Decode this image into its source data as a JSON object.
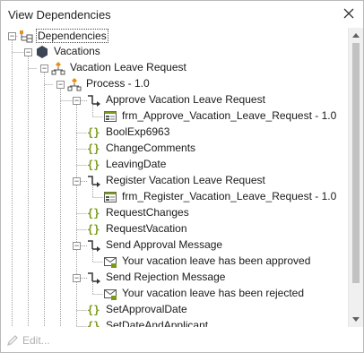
{
  "window": {
    "title": "View Dependencies"
  },
  "tree": {
    "root": "Dependencies",
    "vacations": "Vacations",
    "vacation_leave_request": "Vacation Leave Request",
    "process": "Process - 1.0",
    "items": [
      "Approve Vacation Leave Request",
      "frm_Approve_Vacation_Leave_Request - 1.0",
      "BoolExp6963",
      "ChangeComments",
      "LeavingDate",
      "Register Vacation Leave Request",
      "frm_Register_Vacation_Leave_Request - 1.0",
      "RequestChanges",
      "RequestVacation",
      "Send Approval Message",
      "Your vacation leave has been approved",
      "Send Rejection Message",
      "Your vacation leave has been rejected",
      "SetApprovalDate",
      "SetDateAndApplicant"
    ]
  },
  "footer": {
    "edit_label": "Edit..."
  },
  "icons": {
    "close": "close-icon",
    "root": "dependencies-tree-icon",
    "app": "hexagon-icon",
    "process": "process-flow-icon",
    "activity": "activity-arrow-icon",
    "form": "form-icon",
    "expression": "braces-icon",
    "message": "envelope-icon",
    "edit": "pencil-icon"
  },
  "colors": {
    "accent_orange": "#e8901c",
    "braces_green": "#7a9a1a",
    "disabled_text": "#b0b0b0"
  }
}
